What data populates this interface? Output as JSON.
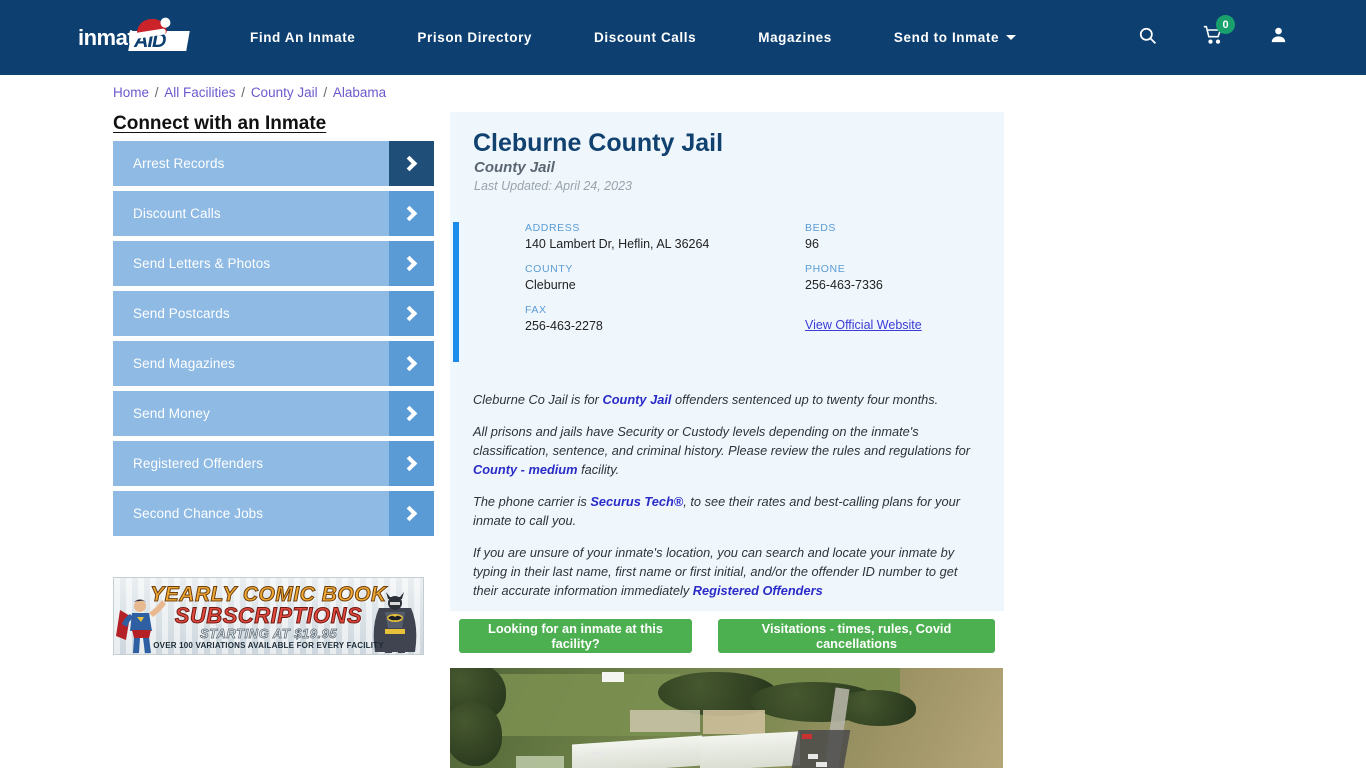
{
  "colors": {
    "nav_bg": "#0d4071",
    "accent_blue": "#1b8ceb",
    "sidebar_button": "#8ebae4",
    "sidebar_arrow": "#5a9bd5",
    "sidebar_arrow_active": "#1f4e79",
    "green_button": "#4caf50",
    "card_bg": "#eff7fd",
    "title_blue": "#10416f",
    "badge_green": "#1aa06d"
  },
  "header": {
    "logo": {
      "text": "inmate",
      "accent": "AID",
      "icon": "santa-hat-icon"
    },
    "nav": [
      {
        "label": "Find An Inmate",
        "caret": false
      },
      {
        "label": "Prison Directory",
        "caret": false
      },
      {
        "label": "Discount Calls",
        "caret": false
      },
      {
        "label": "Magazines",
        "caret": false
      },
      {
        "label": "Send to Inmate",
        "caret": true
      }
    ],
    "icons": {
      "search": "search-icon",
      "cart": "shopping-cart-icon",
      "cart_count": "0",
      "account": "user-account-icon"
    }
  },
  "breadcrumb": {
    "items": [
      "Home",
      "All Facilities",
      "County Jail",
      "Alabama"
    ],
    "separator": "/"
  },
  "sidebar": {
    "heading": "Connect with an Inmate",
    "items": [
      {
        "label": "Arrest Records",
        "active": true
      },
      {
        "label": "Discount Calls",
        "active": false
      },
      {
        "label": "Send Letters & Photos",
        "active": false
      },
      {
        "label": "Send Postcards",
        "active": false
      },
      {
        "label": "Send Magazines",
        "active": false
      },
      {
        "label": "Send Money",
        "active": false
      },
      {
        "label": "Registered Offenders",
        "active": false
      },
      {
        "label": "Second Chance Jobs",
        "active": false
      }
    ]
  },
  "ad": {
    "line1": "YEARLY COMIC BOOK",
    "line2": "SUBSCRIPTIONS",
    "line3": "STARTING AT $19.95",
    "line4": "OVER 100 VARIATIONS AVAILABLE FOR EVERY FACILITY"
  },
  "facility": {
    "title": "Cleburne County Jail",
    "subtitle": "County Jail",
    "last_updated": "Last Updated: April 24, 2023",
    "fields": {
      "address_label": "ADDRESS",
      "address_value": "140 Lambert Dr, Heflin, AL 36264",
      "beds_label": "BEDS",
      "beds_value": "96",
      "county_label": "COUNTY",
      "county_value": "Cleburne",
      "phone_label": "PHONE",
      "phone_value": "256-463-7336",
      "fax_label": "FAX",
      "fax_value": "256-463-2278",
      "website_link": "View Official Website"
    }
  },
  "description": {
    "p1_a": "Cleburne Co Jail is for ",
    "p1_link": "County Jail",
    "p1_b": " offenders sentenced up to twenty four months.",
    "p2_a": "All prisons and jails have Security or Custody levels depending on the inmate's classification, sentence, and criminal history. Please review the rules and regulations for ",
    "p2_link": "County - medium",
    "p2_b": " facility.",
    "p3_a": "The phone carrier is ",
    "p3_link": "Securus Tech®",
    "p3_b": ", to see their rates and best-calling plans for your inmate to call you.",
    "p4_a": "If you are unsure of your inmate's location, you can search and locate your inmate by typing in their last name, first name or first initial, and/or the offender ID number to get their accurate information immediately ",
    "p4_link": "Registered Offenders"
  },
  "actions": {
    "find_inmate": "Looking for an inmate at this facility?",
    "visitations": "Visitations - times, rules, Covid cancellations"
  },
  "satellite": {
    "alt": "aerial-satellite-view-of-facility"
  }
}
